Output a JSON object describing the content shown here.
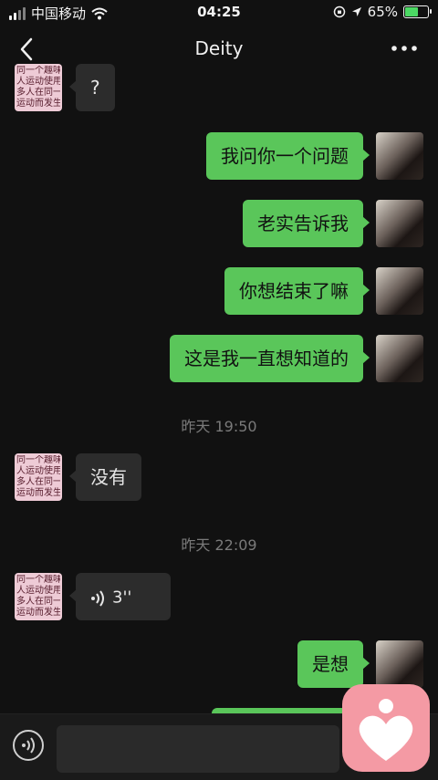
{
  "status_bar": {
    "carrier": "中国移动",
    "time": "04:25",
    "battery_percent": "65%",
    "battery_level": 0.65
  },
  "nav": {
    "title": "Deity"
  },
  "avatar_text": "同一个趣味\n人运动使用\n多人在同一\n运动而发生",
  "messages": [
    {
      "side": "left",
      "text": "?"
    },
    {
      "side": "right",
      "text": "我问你一个问题"
    },
    {
      "side": "right",
      "text": "老实告诉我"
    },
    {
      "side": "right",
      "text": "你想结束了嘛"
    },
    {
      "side": "right",
      "text": "这是我一直想知道的"
    },
    {
      "side": "left",
      "text": "没有"
    },
    {
      "side": "left",
      "text": "3''"
    },
    {
      "side": "right",
      "text": "是想"
    }
  ],
  "timestamps": [
    "昨天 19:50",
    "昨天 22:09"
  ],
  "colors": {
    "background": "#111111",
    "sent_bubble": "#5ac65a",
    "received_bubble": "#2c2c2c",
    "app_icon": "#f49aa4"
  },
  "icons": {
    "back": "chevron-left-icon",
    "more": "more-dots-icon",
    "voice": "voice-input-icon",
    "voice_message": "sound-wave-icon",
    "app": "heart-person-icon"
  }
}
